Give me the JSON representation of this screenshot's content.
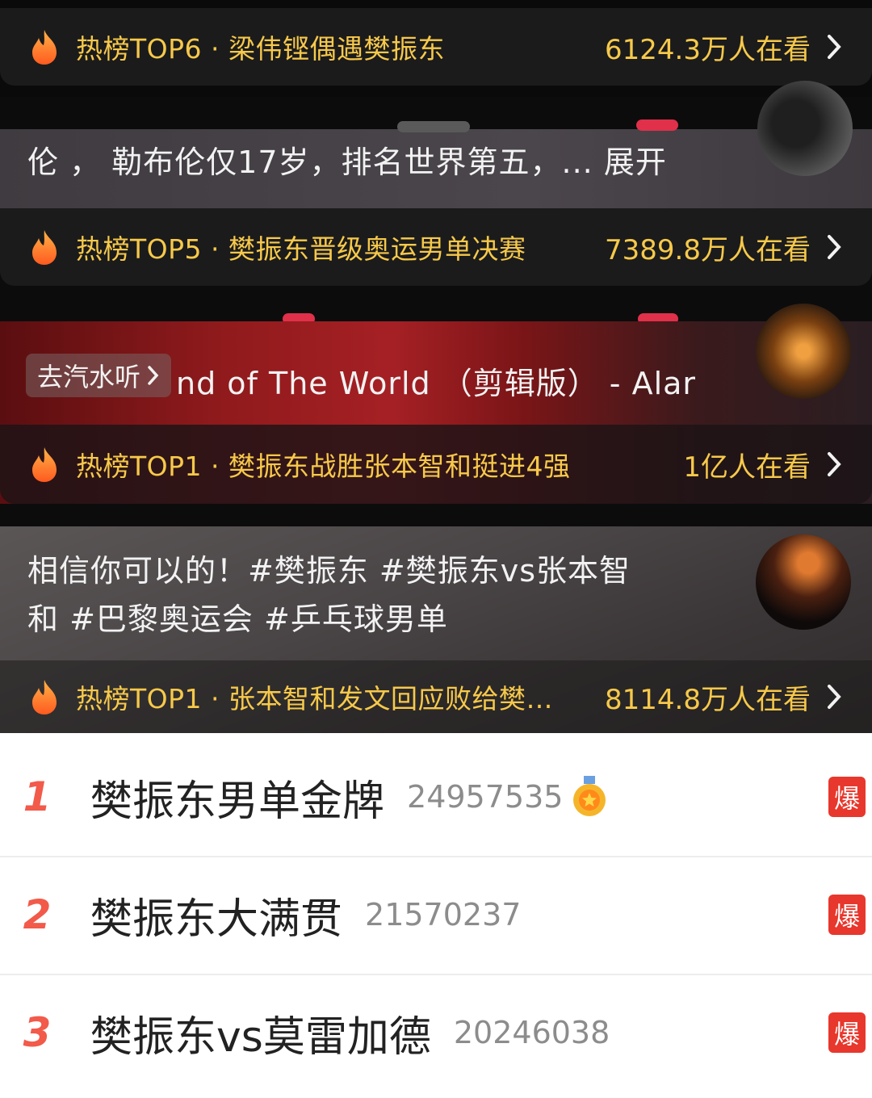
{
  "hot_items": [
    {
      "text": "热榜TOP6 · 梁伟铿偶遇樊振东",
      "views": "6124.3万人在看"
    },
    {
      "text": "热榜TOP5 · 樊振东晋级奥运男单决赛",
      "views": "7389.8万人在看"
    },
    {
      "text": "热榜TOP1 · 樊振东战胜张本智和挺进4强",
      "views": "1亿人在看"
    },
    {
      "text": "热榜TOP1 · 张本智和发文回应败给樊…",
      "views": "8114.8万人在看"
    }
  ],
  "captions": {
    "c1": "伦 ， 勒布伦仅17岁，排名世界第五，... 展开",
    "music_tag": "去汽水听",
    "music_title": "nd of The World （剪辑版） - Alar",
    "c3_line1": "相信你可以的！#樊振东 #樊振东vs张本智",
    "c3_line2": "和 #巴黎奥运会 #乒乓球男单"
  },
  "trending": [
    {
      "rank": "1",
      "title": "樊振东男单金牌",
      "count": "24957535",
      "badge": "爆"
    },
    {
      "rank": "2",
      "title": "樊振东大满贯",
      "count": "21570237",
      "badge": "爆"
    },
    {
      "rank": "3",
      "title": "樊振东vs莫雷加德",
      "count": "20246038",
      "badge": "爆"
    }
  ],
  "colors": {
    "hot_text": "#f7c94a",
    "rank": "#f25a4a",
    "badge": "#e8372c"
  }
}
